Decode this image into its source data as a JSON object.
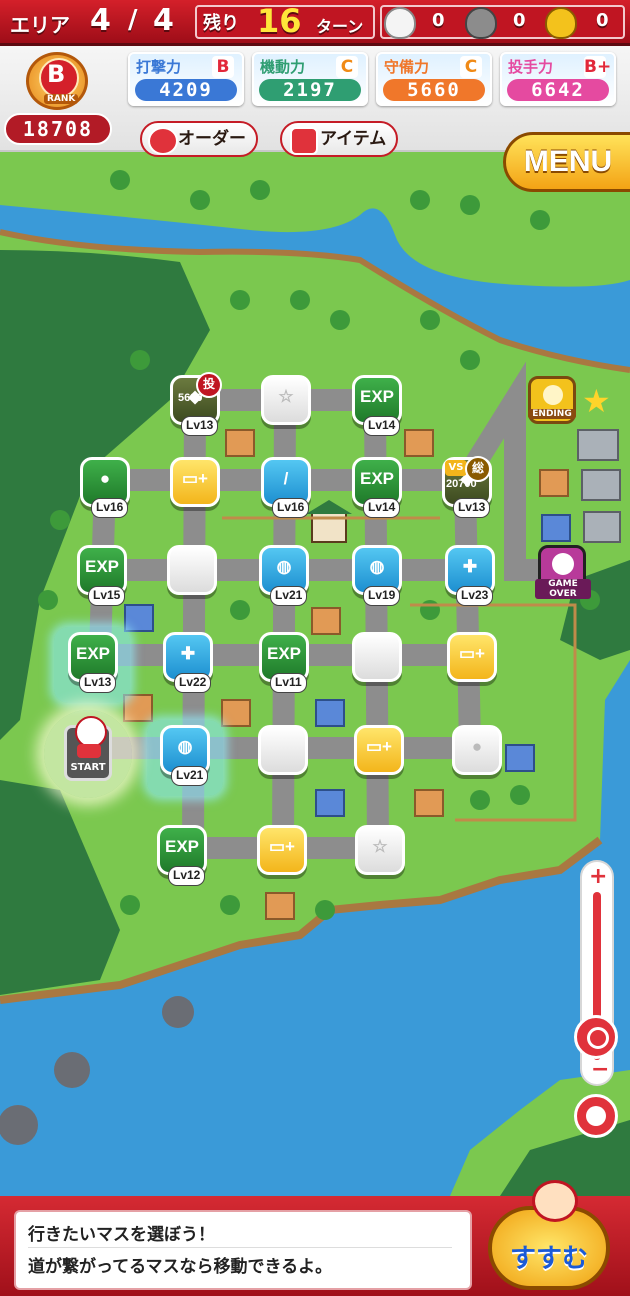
{
  "header": {
    "area_label": "エリア",
    "area_current": "4",
    "area_sep": "/",
    "area_total": "4",
    "remaining_label": "残り",
    "turns_left": "16",
    "turn_label": "ターン",
    "bag_white_count": "0",
    "bag_gray_count": "0",
    "bag_gold_count": "0"
  },
  "rank": {
    "grade": "B",
    "caption": "RANK",
    "score": "18708"
  },
  "stats": [
    {
      "label": "打撃力",
      "grade": "B",
      "value": "4209",
      "color": "#3a78d6",
      "grade_color": "#e2283a"
    },
    {
      "label": "機動力",
      "grade": "C",
      "value": "2197",
      "color": "#2f9e72",
      "grade_color": "#f08a16"
    },
    {
      "label": "守備力",
      "grade": "C",
      "value": "5660",
      "color": "#f0772a",
      "grade_color": "#f08a16"
    },
    {
      "label": "投手力",
      "grade": "B+",
      "value": "6642",
      "color": "#e54aa0",
      "grade_color": "#e2283a"
    }
  ],
  "buttons": {
    "order": "オーダー",
    "item": "アイテム",
    "menu": "MENU",
    "go": "すすむ"
  },
  "map_labels": {
    "ending": "ENDING",
    "game_over": "GAME OVER",
    "start": "START",
    "pitch": "投",
    "vs": "VS",
    "total": "総",
    "pitch_value": "5630",
    "vs_value": "20700"
  },
  "tiles": [
    {
      "id": "r1c1",
      "kind": "dark",
      "glyph": "◆",
      "lv": "Lv13"
    },
    {
      "id": "r1c2",
      "kind": "white",
      "glyph": "☆",
      "lv": ""
    },
    {
      "id": "r1c3",
      "kind": "green",
      "glyph": "EXP",
      "lv": "Lv14"
    },
    {
      "id": "r2c0",
      "kind": "green",
      "glyph": "●",
      "lv": "Lv16"
    },
    {
      "id": "r2c1",
      "kind": "yellow",
      "glyph": "▭+",
      "lv": ""
    },
    {
      "id": "r2c2",
      "kind": "blue",
      "glyph": "/",
      "lv": "Lv16"
    },
    {
      "id": "r2c3",
      "kind": "green",
      "glyph": "EXP",
      "lv": "Lv14"
    },
    {
      "id": "r2c4",
      "kind": "dark",
      "glyph": "◆",
      "lv": "Lv13"
    },
    {
      "id": "r3c0",
      "kind": "green",
      "glyph": "EXP",
      "lv": "Lv15"
    },
    {
      "id": "r3c1",
      "kind": "white",
      "glyph": "",
      "lv": ""
    },
    {
      "id": "r3c2",
      "kind": "blue",
      "glyph": "◍",
      "lv": "Lv21"
    },
    {
      "id": "r3c3",
      "kind": "blue",
      "glyph": "◍",
      "lv": "Lv19"
    },
    {
      "id": "r3c4",
      "kind": "blue",
      "glyph": "✚",
      "lv": "Lv23"
    },
    {
      "id": "r4c0",
      "kind": "green",
      "glyph": "EXP",
      "lv": "Lv13"
    },
    {
      "id": "r4c1",
      "kind": "blue",
      "glyph": "✚",
      "lv": "Lv22"
    },
    {
      "id": "r4c2",
      "kind": "green",
      "glyph": "EXP",
      "lv": "Lv11"
    },
    {
      "id": "r4c3",
      "kind": "white",
      "glyph": "",
      "lv": ""
    },
    {
      "id": "r4c4",
      "kind": "yellow",
      "glyph": "▭+",
      "lv": ""
    },
    {
      "id": "r5c1",
      "kind": "blue",
      "glyph": "◍",
      "lv": "Lv21"
    },
    {
      "id": "r5c2",
      "kind": "white",
      "glyph": "",
      "lv": ""
    },
    {
      "id": "r5c3",
      "kind": "yellow",
      "glyph": "▭+",
      "lv": ""
    },
    {
      "id": "r5c4",
      "kind": "white",
      "glyph": "●",
      "lv": ""
    },
    {
      "id": "r6c1",
      "kind": "green",
      "glyph": "EXP",
      "lv": "Lv12"
    },
    {
      "id": "r6c2",
      "kind": "yellow",
      "glyph": "▭+",
      "lv": ""
    },
    {
      "id": "r6c3",
      "kind": "white",
      "glyph": "☆",
      "lv": ""
    }
  ],
  "message": {
    "line1": "行きたいマスを選ぼう！",
    "line2": "道が繋がってるマスなら移動できるよ。"
  },
  "colors": {
    "accent": "#d4202a",
    "grass": "#6fc24a",
    "water": "#3a9ad8",
    "road": "#8d8d8d"
  }
}
